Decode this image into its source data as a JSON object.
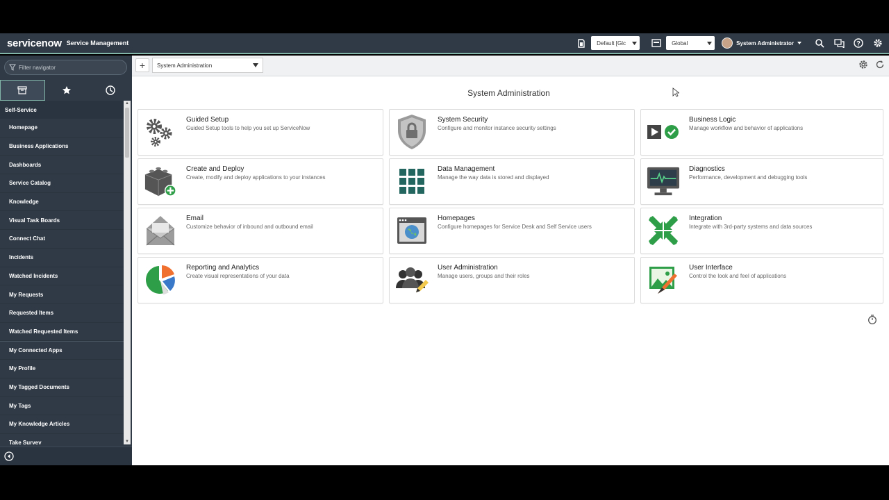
{
  "header": {
    "logo": "servicenow",
    "product": "Service Management",
    "update_set": "Default [Glc",
    "scope": "Global",
    "user_name": "System Administrator"
  },
  "sidebar": {
    "filter_placeholder": "Filter navigator",
    "section": "Self-Service",
    "items": [
      "Homepage",
      "Business Applications",
      "Dashboards",
      "Service Catalog",
      "Knowledge",
      "Visual Task Boards",
      "Connect Chat",
      "Incidents",
      "Watched Incidents",
      "My Requests",
      "Requested Items",
      "Watched Requested Items",
      "My Connected Apps",
      "My Profile",
      "My Tagged Documents",
      "My Tags",
      "My Knowledge Articles",
      "Take Survey"
    ]
  },
  "toolbar": {
    "add": "+",
    "dashboard_select": "System Administration"
  },
  "page": {
    "title": "System Administration",
    "cards": [
      {
        "title": "Guided Setup",
        "desc": "Guided Setup tools to help you set up ServiceNow",
        "icon": "gears-icon"
      },
      {
        "title": "System Security",
        "desc": "Configure and monitor instance security settings",
        "icon": "shield-lock-icon"
      },
      {
        "title": "Business Logic",
        "desc": "Manage workflow and behavior of applications",
        "icon": "play-check-icon"
      },
      {
        "title": "Create and Deploy",
        "desc": "Create, modify and deploy applications to your instances",
        "icon": "blocks-add-icon"
      },
      {
        "title": "Data Management",
        "desc": "Manage the way data is stored and displayed",
        "icon": "data-grid-icon"
      },
      {
        "title": "Diagnostics",
        "desc": "Performance, development and debugging tools",
        "icon": "monitor-pulse-icon"
      },
      {
        "title": "Email",
        "desc": "Customize behavior of inbound and outbound email",
        "icon": "envelope-icon"
      },
      {
        "title": "Homepages",
        "desc": "Configure homepages for Service Desk and Self Service users",
        "icon": "browser-globe-icon"
      },
      {
        "title": "Integration",
        "desc": "Integrate with 3rd-party systems and data sources",
        "icon": "arrows-in-icon"
      },
      {
        "title": "Reporting and Analytics",
        "desc": "Create visual representations of your data",
        "icon": "pie-chart-icon"
      },
      {
        "title": "User Administration",
        "desc": "Manage users, groups and their roles",
        "icon": "users-edit-icon"
      },
      {
        "title": "User Interface",
        "desc": "Control the look and feel of applications",
        "icon": "picture-brush-icon"
      }
    ]
  },
  "colors": {
    "header_bg": "#303a46",
    "accent": "#82b6a8",
    "green": "#2e9e48",
    "teal": "#23655f"
  }
}
